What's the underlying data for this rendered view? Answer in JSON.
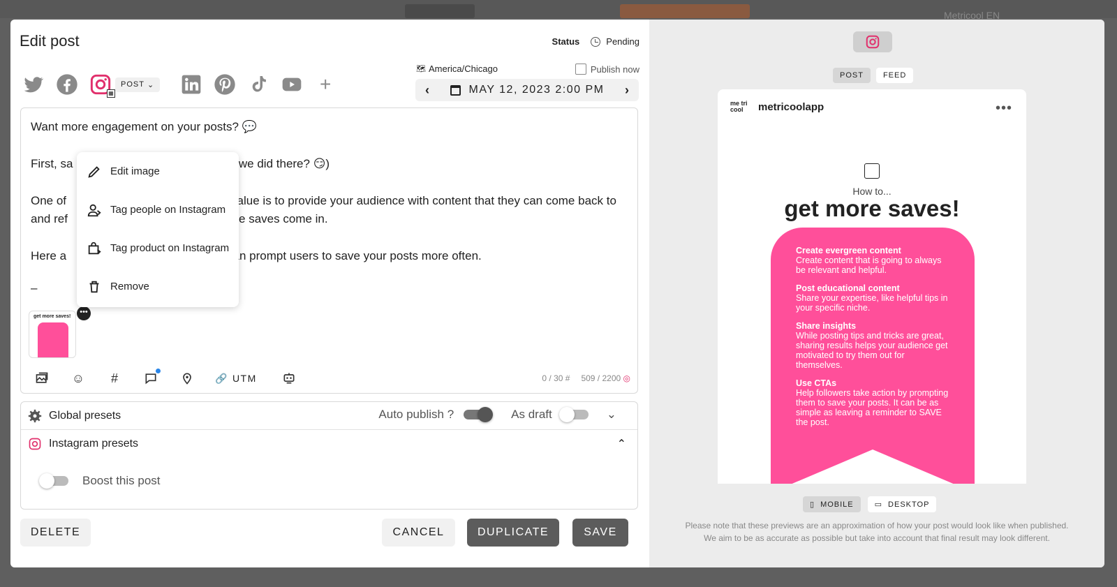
{
  "backdrop": {
    "user_label": "Metricool EN"
  },
  "header": {
    "title": "Edit post",
    "status_label": "Status",
    "status_value": "Pending"
  },
  "networks": {
    "post_type": "POST"
  },
  "schedule": {
    "timezone": "America/Chicago",
    "publish_now": "Publish now",
    "date": "MAY 12, 2023 2:00 PM"
  },
  "editor": {
    "line1": "Want more engagement on your posts? 💬",
    "line2a": "First, sa",
    "line2b": "t we did there? 😏)",
    "line3a": "One of",
    "line3b": "value is to provide your audience with content that they can come back to",
    "line4a": "and ref",
    "line4b": "ere saves come in.",
    "line5a": "Here a",
    "line5b": "can prompt users to save your posts more often.",
    "line6": "–",
    "thumb_text": "get more saves!"
  },
  "context_menu": {
    "items": [
      {
        "label": "Edit image",
        "icon": "pencil-icon"
      },
      {
        "label": "Tag people on Instagram",
        "icon": "person-tag-icon"
      },
      {
        "label": "Tag product on Instagram",
        "icon": "shopping-bag-icon"
      },
      {
        "label": "Remove",
        "icon": "trash-icon"
      }
    ]
  },
  "toolbar": {
    "utm_label": "UTM",
    "hashtag_count": "0 / 30",
    "char_count": "509 / 2200"
  },
  "presets": {
    "global_label": "Global presets",
    "auto_publish_label": "Auto publish ?",
    "as_draft_label": "As draft",
    "instagram_label": "Instagram presets",
    "boost_label": "Boost this post"
  },
  "buttons": {
    "delete": "DELETE",
    "cancel": "CANCEL",
    "duplicate": "DUPLICATE",
    "save": "SAVE"
  },
  "preview": {
    "tab_post": "POST",
    "tab_feed": "FEED",
    "account": "metricoolapp",
    "logo_text": "me tri cool",
    "how_to": "How to...",
    "headline": "get more saves!",
    "tips": [
      {
        "title": "Create evergreen content",
        "body": "Create content that is going to always be relevant and helpful."
      },
      {
        "title": "Post educational content",
        "body": "Share your expertise, like helpful tips in your specific niche."
      },
      {
        "title": "Share insights",
        "body": "While posting tips and tricks are great, sharing results helps your audience get motivated to try them out for themselves."
      },
      {
        "title": "Use CTAs",
        "body": "Help followers take action by prompting them to save your posts. It can be as simple as leaving a reminder to SAVE the post."
      }
    ],
    "view_mobile": "MOBILE",
    "view_desktop": "DESKTOP",
    "note_line1": "Please note that these previews are an approximation of how your post would look like when published.",
    "note_line2": "We aim to be as accurate as possible but take into account that final result may look different."
  },
  "colors": {
    "instagram": "#e1306c",
    "ribbon": "#ff4f9a",
    "dark_button": "#5c5c5c"
  }
}
